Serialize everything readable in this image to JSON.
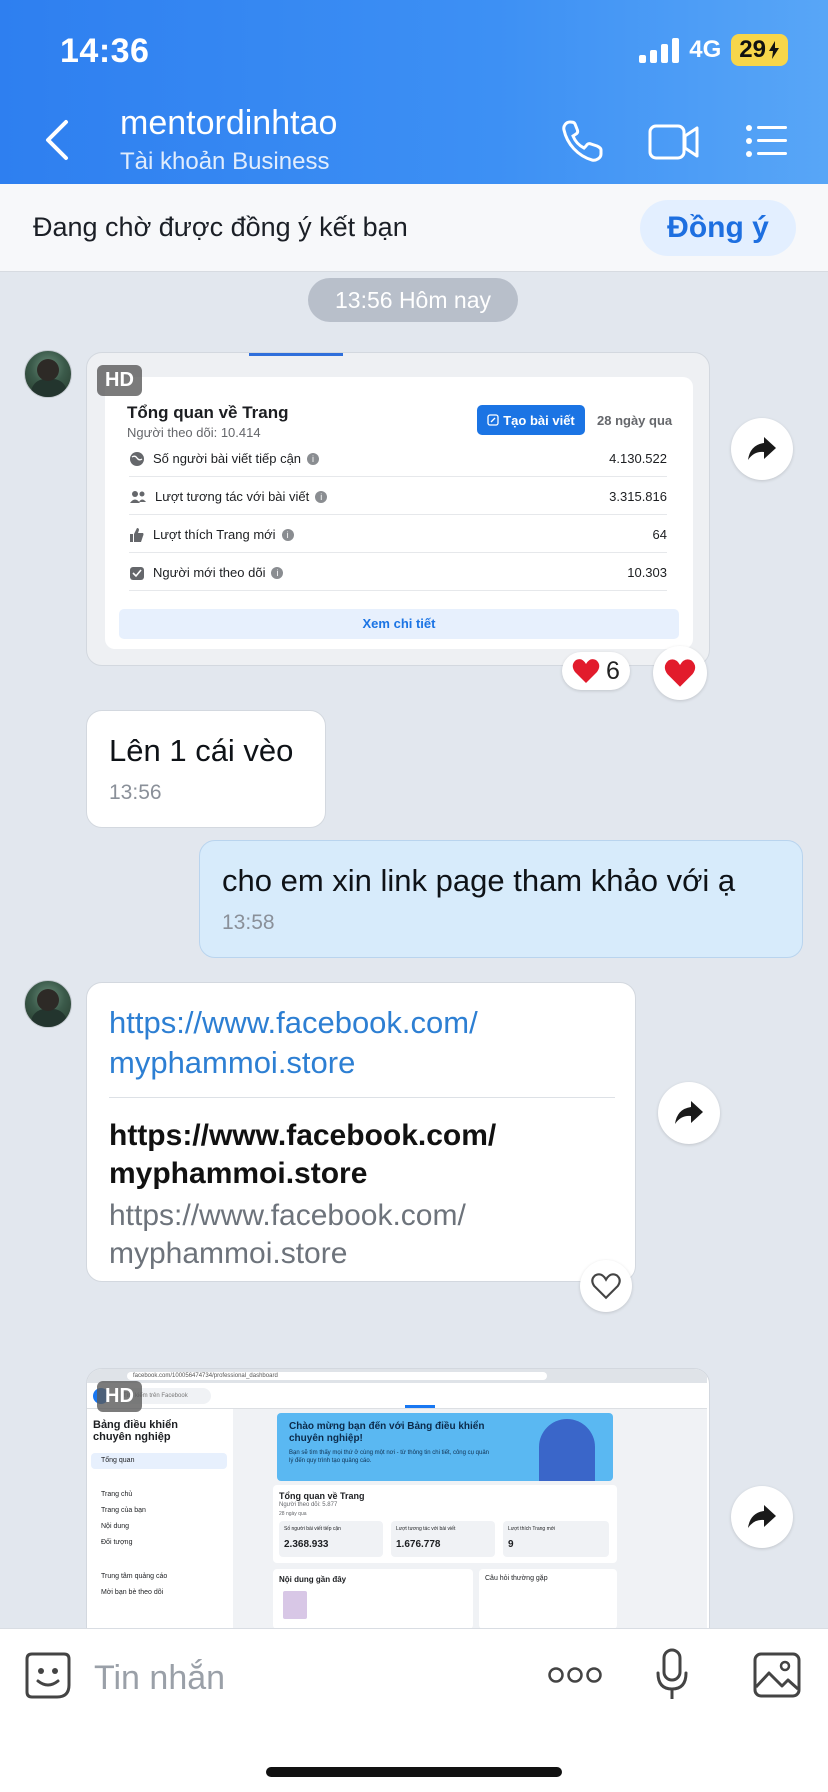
{
  "status": {
    "time": "14:36",
    "network": "4G",
    "battery": "29"
  },
  "header": {
    "name": "mentordinhtao",
    "subtitle": "Tài khoản Business"
  },
  "friend_request": {
    "text": "Đang chờ được đồng ý kết bạn",
    "accept_label": "Đồng ý"
  },
  "chat": {
    "date_divider": "13:56 Hôm nay",
    "messages": [
      {
        "type": "image",
        "hd": "HD",
        "fb_overview": {
          "title": "Tổng quan về Trang",
          "followers": "Người theo dõi: 10.414",
          "create_label": "Tạo bài viết",
          "period": "28 ngày qua",
          "rows": [
            {
              "label": "Số người bài viết tiếp cận",
              "value": "4.130.522"
            },
            {
              "label": "Lượt tương tác với bài viết",
              "value": "3.315.816"
            },
            {
              "label": "Lượt thích Trang mới",
              "value": "64"
            },
            {
              "label": "Người mới theo dõi",
              "value": "10.303"
            }
          ],
          "details_label": "Xem chi tiết"
        },
        "reaction_count": "6"
      },
      {
        "type": "text",
        "text": "Lên 1 cái vèo",
        "time": "13:56"
      },
      {
        "type": "text-out",
        "text": "cho em xin link page tham khảo với ạ",
        "time": "13:58"
      },
      {
        "type": "link",
        "url": "https://www.facebook.com/\nmyphammoi.store",
        "preview_title": "https://www.facebook.com/\nmyphammoi.store",
        "preview_url": "https://www.facebook.com/\nmyphammoi.store"
      },
      {
        "type": "image",
        "hd": "HD",
        "dashboard": {
          "url": "facebook.com/100056474734/professional_dashboard",
          "search": "Tìm kiếm trên Facebook",
          "sidebar_title": "Bảng điều khiển chuyên nghiệp",
          "sidebar_items": [
            "Tổng quan",
            "Trang chủ",
            "Trang của bạn",
            "Nội dung",
            "Đối tượng",
            "Trung tâm quảng cáo",
            "Mời bạn bè theo dõi"
          ],
          "banner_title": "Chào mừng bạn đến với Bảng điều khiển chuyên nghiệp!",
          "banner_text": "Bạn sẽ tìm thấy mọi thứ ở cùng một nơi - từ thông tin chi tiết, công cụ quản lý đến quy trình tạo quảng cáo.",
          "overview_title": "Tổng quan về Trang",
          "overview_followers": "Người theo dõi: 5.877",
          "overview_period": "28 ngày qua",
          "stats": [
            {
              "label": "Số người bài viết tiếp cận",
              "value": "2.368.933"
            },
            {
              "label": "Lượt tương tác với bài viết",
              "value": "1.676.778"
            },
            {
              "label": "Lượt thích Trang mới",
              "value": "9"
            }
          ],
          "recent_title": "Nội dung gần đây",
          "faq_title": "Câu hỏi thường gặp"
        }
      }
    ]
  },
  "input": {
    "placeholder": "Tin nhắn"
  }
}
